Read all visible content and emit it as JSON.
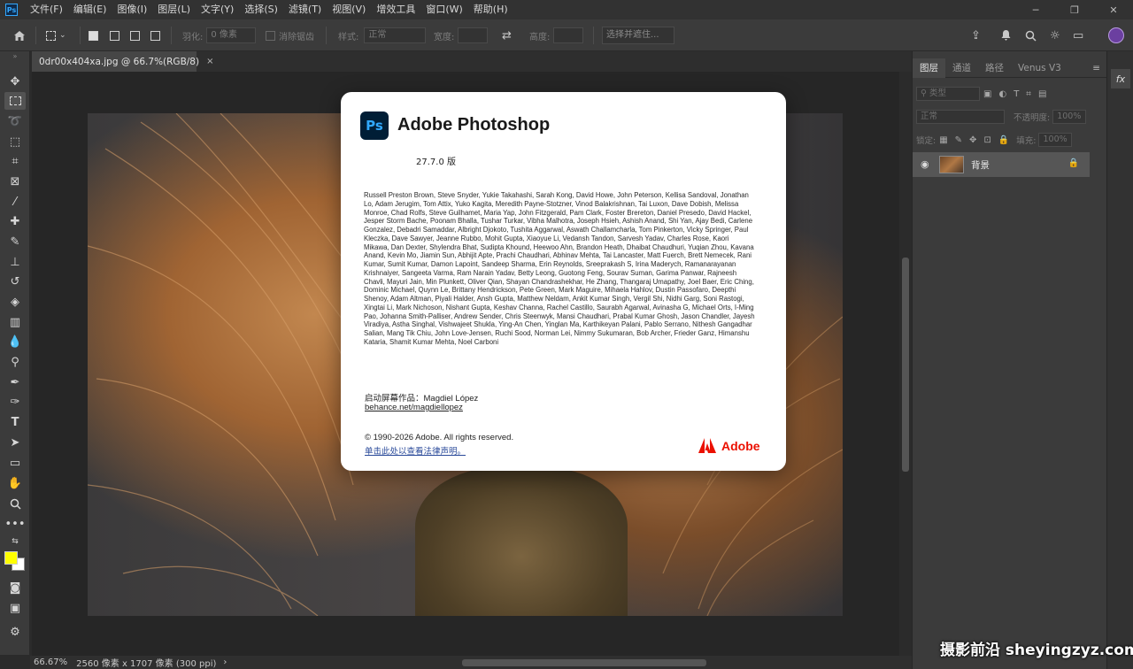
{
  "menubar": {
    "app_icon": "Ps",
    "items": [
      "文件(F)",
      "编辑(E)",
      "图像(I)",
      "图层(L)",
      "文字(Y)",
      "选择(S)",
      "滤镜(T)",
      "视图(V)",
      "增效工具",
      "窗口(W)",
      "帮助(H)"
    ],
    "window_controls": [
      "minimize-icon",
      "restore-icon",
      "close-icon"
    ]
  },
  "options_bar": {
    "feather_label": "羽化:",
    "feather_value": "0 像素",
    "antialias_label": "消除锯齿",
    "style_label": "样式:",
    "style_value": "正常",
    "width_label": "宽度:",
    "height_label": "高度:",
    "select_mask_label": "选择并遮住..."
  },
  "document": {
    "tab_title": "0dr00x404xa.jpg @ 66.7%(RGB/8)",
    "tab_close": "×"
  },
  "statusbar": {
    "zoom": "66.67%",
    "info": "2560 像素 x 1707 像素 (300 ppi)",
    "arrow": "›"
  },
  "layers_panel": {
    "tabs": [
      "图层",
      "通道",
      "路径",
      "Venus V3"
    ],
    "filter_kind": "类型",
    "blend_mode": "正常",
    "opacity_label": "不透明度:",
    "opacity_value": "100%",
    "lock_label": "锁定:",
    "fill_label": "填充:",
    "fill_value": "100%",
    "layer_name": "背景"
  },
  "about_dialog": {
    "logo": "Ps",
    "title": "Adobe Photoshop",
    "version": "27.7.0 版",
    "credits": "Russell Preston Brown, Steve Snyder, Yukie Takahashi, Sarah Kong, David Howe, John Peterson, Kellisa Sandoval, Jonathan Lo, Adam Jerugim, Tom Attix, Yuko Kagita, Meredith Payne-Stotzner, Vinod Balakrishnan, Tai Luxon, Dave Dobish, Melissa Monroe, Chad Rolfs, Steve Guilhamet, Maria Yap, John Fitzgerald, Pam Clark, Foster Brereton, Daniel Presedo, David Hackel, Jesper Storm Bache, Poonam Bhalla, Tushar Turkar, Vibha Malhotra, Joseph Hsieh, Ashish Anand, Shi Yan, Ajay Bedi, Carlene Gonzalez, Debadri Samaddar, Albright Djokoto, Tushita Aggarwal, Aswath Challamcharla, Tom Pinkerton, Vicky Springer, Paul Kleczka, Dave Sawyer, Jeanne Rubbo, Mohit Gupta, Xiaoyue Li, Vedansh Tandon, Sarvesh Yadav, Charles Rose, Kaori Mikawa, Dan Dexter, Shylendra Bhat, Sudipta Khound, Heewoo Ahn, Brandon Heath, Dhaibat Chaudhuri, Yuqian Zhou, Kavana Anand, Kevin Mo, Jiamin Sun, Abhijit Apte, Prachi Chaudhari, Abhinav Mehta, Tai Lancaster, Matt Fuerch, Brett Nemecek, Rani Kumar, Sumit Kumar, Damon Lapoint, Sandeep Sharma, Erin Reynolds, Sreeprakash S, Irina Maderych, Ramanarayanan Krishnaiyer, Sangeeta Varma, Ram Narain Yadav, Betty Leong, Guotong Feng, Sourav Suman, Garima Panwar, Rajneesh Chavli, Mayuri Jain, Min Plunkett, Oliver Qian, Shayan Chandrashekhar, He Zhang, Thangaraj Umapathy, Joel Baer, Eric Ching, Dominic Michael, Quynn Le, Brittany Hendrickson, Pete Green, Mark Maguire, Mihaela Hahlov, Dustin Passofaro, Deepthi Shenoy, Adam Altman, Piyali Halder, Ansh Gupta, Matthew Neldam, Ankit Kumar Singh, Vergil Shi, Nidhi Garg, Soni Rastogi, Xingtai Li, Mark Nichoson, Nishant Gupta, Keshav Channa, Rachel Castillo, Saurabh Agarwal, Avinasha G, Michael Orts, I-Ming Pao, Johanna Smith-Palliser, Andrew Sender, Chris Steenwyk, Mansi Chaudhari, Prabal Kumar Ghosh, Jason Chandler, Jayesh Viradiya, Astha Singhal, Vishwajeet Shukla, Ying-An Chen, Yinglan Ma, Karthikeyan Palani, Pablo Serrano, Nithesh Gangadhar Salian, Mang Tik Chiu, John Love-Jensen, Ruchi Sood, Norman Lei, Nimmy Sukumaran, Bob Archer, Frieder Ganz, Himanshu Kataria, Shamit Kumar Mehta, Noel Carboni",
    "splash_credit": "启动屏幕作品：Magdiel López",
    "behance": "behance.net/magdiellopez",
    "copyright": "© 1990-2026 Adobe. All rights reserved.",
    "legal_link": "单击此处以查看法律声明。",
    "brand": "Adobe",
    "brand_color": "#eb1000"
  },
  "tools": [
    "move-icon",
    "marquee-icon",
    "lasso-icon",
    "object-select-icon",
    "crop-icon",
    "frame-icon",
    "eyedropper-icon",
    "healing-icon",
    "brush-icon",
    "stamp-icon",
    "history-brush-icon",
    "eraser-icon",
    "gradient-icon",
    "blur-icon",
    "dodge-icon",
    "pen-icon",
    "type-icon",
    "path-select-icon",
    "rectangle-icon",
    "hand-icon",
    "zoom-icon",
    "more-icon"
  ],
  "colors": {
    "foreground": "#ffff00",
    "background": "#ffffff",
    "accent": "#31a8ff"
  },
  "watermark": "摄影前沿 sheyingzyz.com"
}
